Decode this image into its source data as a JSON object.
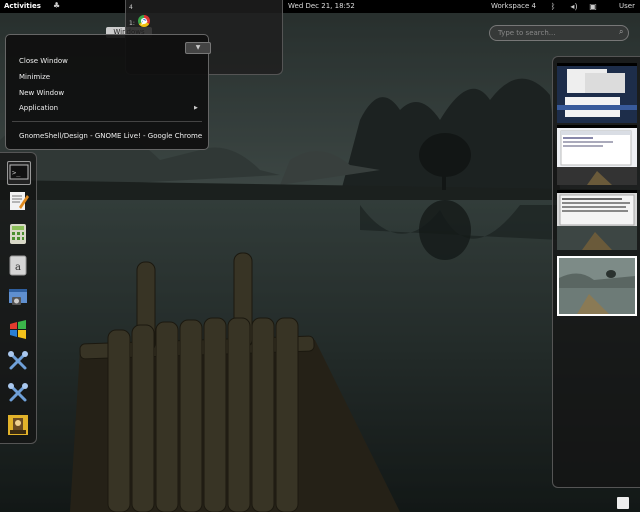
{
  "top_panel": {
    "activities": "Activities",
    "clock": "Wed Dec 21, 18:52",
    "workspace": "Workspace 4",
    "user": "User",
    "app_menu_icon": "gnome-foot-icon",
    "tray_icons": [
      "bluetooth-icon",
      "volume-icon",
      "network-icon"
    ]
  },
  "search": {
    "placeholder": "Type to search..."
  },
  "overview": {
    "windows_tab": "Windows"
  },
  "switcher": {
    "index_top": "4",
    "index_active": "1:",
    "app_icon": "chrome-icon"
  },
  "window_menu": {
    "items": [
      "Close Window",
      "Minimize",
      "New Window",
      "Application"
    ],
    "submenu_arrow": "▶",
    "window_title": "GnomeShell/Design - GNOME Live! - Google Chrome"
  },
  "dash": {
    "icons": [
      "terminal-icon",
      "text-editor-icon",
      "calculator-icon",
      "dictionary-icon",
      "screenshot-icon",
      "windows-app-icon",
      "tools-icon",
      "tools-icon-2",
      "game-icon"
    ]
  },
  "workspaces": {
    "count": 4,
    "active_index": 3
  }
}
